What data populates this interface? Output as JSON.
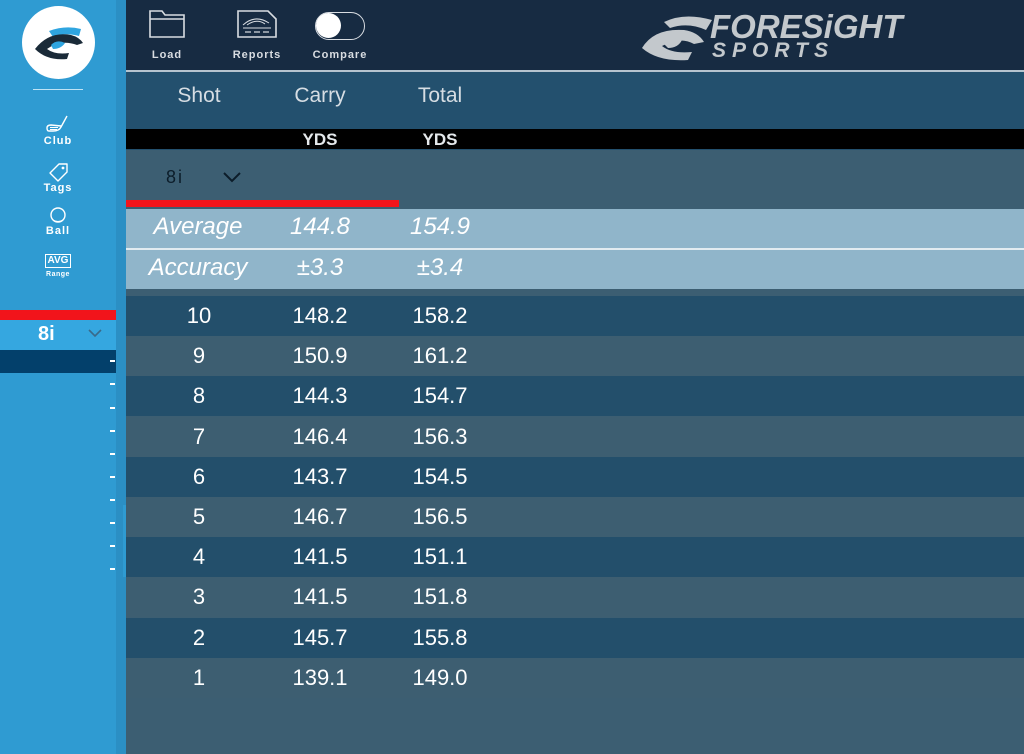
{
  "sidebar": {
    "logo": "foresight-eye-logo",
    "items": [
      {
        "label": "Club",
        "icon": "golf-club-icon"
      },
      {
        "label": "Tags",
        "icon": "tag-icon"
      },
      {
        "label": "Ball",
        "icon": "golf-ball-icon"
      },
      {
        "label": "Range",
        "icon": "avg-icon",
        "badge": "AVG"
      }
    ],
    "club_selector": {
      "value": "8i",
      "icon": "chevron-down-icon"
    }
  },
  "toolbar": {
    "load_label": "Load",
    "reports_label": "Reports",
    "compare_label": "Compare",
    "compare_enabled": false
  },
  "brand": {
    "line1": "FORESiGHT",
    "line2": "SPORTS"
  },
  "colors": {
    "sidebar": "#2f9bd2",
    "topbar": "#172b42",
    "accent_red": "#f2141b",
    "row_dark": "#234f6b",
    "row_light": "#3d5e71",
    "stat_row": "#90b5ca"
  },
  "table": {
    "columns": [
      {
        "label": "Shot",
        "unit": ""
      },
      {
        "label": "Carry",
        "unit": "YDS"
      },
      {
        "label": "Total",
        "unit": "YDS"
      }
    ],
    "filter": {
      "value": "8i"
    },
    "average": {
      "label": "Average",
      "carry": "144.8",
      "total": "154.9"
    },
    "accuracy": {
      "label": "Accuracy",
      "carry": "±3.3",
      "total": "±3.4"
    },
    "rows": [
      {
        "shot": "10",
        "carry": "148.2",
        "total": "158.2"
      },
      {
        "shot": "9",
        "carry": "150.9",
        "total": "161.2"
      },
      {
        "shot": "8",
        "carry": "144.3",
        "total": "154.7"
      },
      {
        "shot": "7",
        "carry": "146.4",
        "total": "156.3"
      },
      {
        "shot": "6",
        "carry": "143.7",
        "total": "154.5"
      },
      {
        "shot": "5",
        "carry": "146.7",
        "total": "156.5"
      },
      {
        "shot": "4",
        "carry": "141.5",
        "total": "151.1"
      },
      {
        "shot": "3",
        "carry": "141.5",
        "total": "151.8"
      },
      {
        "shot": "2",
        "carry": "145.7",
        "total": "155.8"
      },
      {
        "shot": "1",
        "carry": "139.1",
        "total": "149.0"
      }
    ]
  }
}
